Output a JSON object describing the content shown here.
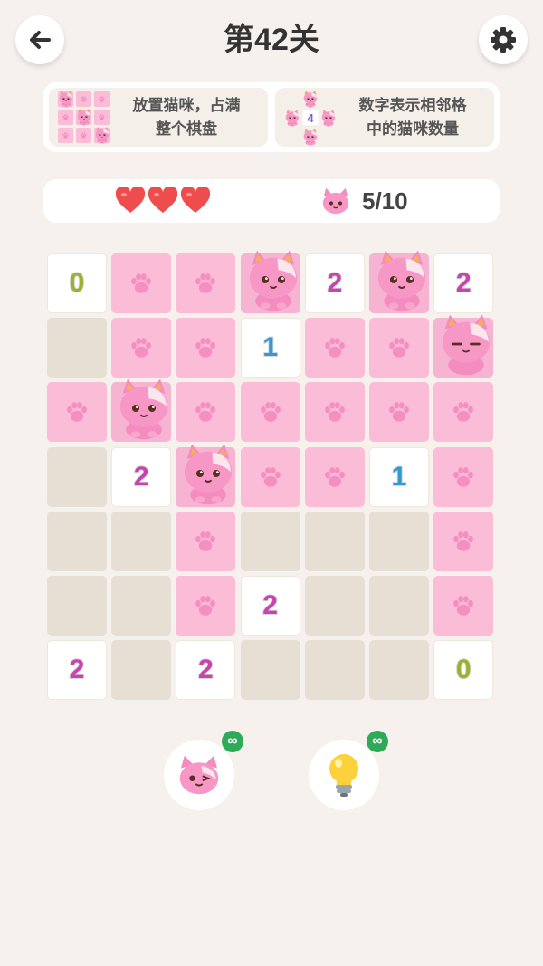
{
  "header": {
    "title": "第42关"
  },
  "instructions": [
    {
      "text": "放置猫咪，占满\n整个棋盘"
    },
    {
      "text": "数字表示相邻格\n中的猫咪数量",
      "thumb_number": "4"
    }
  ],
  "status": {
    "lives": 3,
    "cats_placed": "5/10"
  },
  "board": {
    "size": 7,
    "rows": [
      [
        "num:0",
        "paw",
        "paw",
        "cat",
        "num:2",
        "cat",
        "num:2"
      ],
      [
        "empty",
        "paw",
        "paw",
        "num:1",
        "paw",
        "paw",
        "cat-sleep"
      ],
      [
        "paw",
        "cat",
        "paw",
        "paw",
        "paw",
        "paw",
        "paw"
      ],
      [
        "empty",
        "num:2",
        "cat",
        "paw",
        "paw",
        "num:1",
        "paw"
      ],
      [
        "empty",
        "empty",
        "paw",
        "empty",
        "empty",
        "empty",
        "paw"
      ],
      [
        "empty",
        "empty",
        "paw",
        "num:2",
        "empty",
        "empty",
        "paw"
      ],
      [
        "num:2",
        "empty",
        "num:2",
        "empty",
        "empty",
        "empty",
        "num:0"
      ]
    ]
  },
  "tools": [
    {
      "icon": "cat-wink-icon",
      "badge": "∞"
    },
    {
      "icon": "lightbulb-icon",
      "badge": "∞"
    }
  ],
  "colors": {
    "background": "#f6f1ec",
    "paw_cell": "#fbbcd8",
    "empty_cell": "#e8dfd4",
    "heart": "#ef4d4d"
  }
}
